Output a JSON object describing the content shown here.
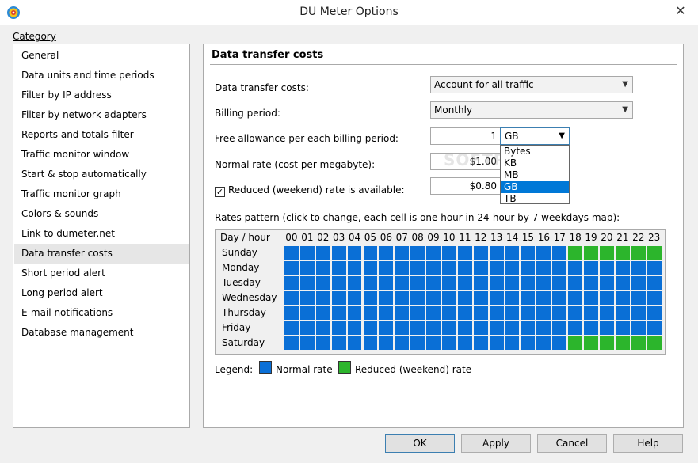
{
  "window": {
    "title": "DU Meter Options",
    "close_glyph": "✕"
  },
  "category": {
    "label": "Category",
    "items": [
      "General",
      "Data units and time periods",
      "Filter by IP address",
      "Filter by network adapters",
      "Reports and totals filter",
      "Traffic monitor window",
      "Start & stop automatically",
      "Traffic monitor graph",
      "Colors & sounds",
      "Link to dumeter.net",
      "Data transfer costs",
      "Short period alert",
      "Long period alert",
      "E-mail notifications",
      "Database management"
    ],
    "selected_index": 10
  },
  "panel": {
    "title": "Data transfer costs",
    "costs_label": "Data transfer costs:",
    "costs_value": "Account for all traffic",
    "billing_label": "Billing period:",
    "billing_value": "Monthly",
    "allowance_label": "Free allowance per each billing period:",
    "allowance_value": "1",
    "unit_value": "GB",
    "unit_options": [
      "Bytes",
      "KB",
      "MB",
      "GB",
      "TB"
    ],
    "unit_selected_index": 3,
    "normal_rate_label": "Normal rate (cost per megabyte):",
    "normal_rate_value": "$1.00",
    "reduced_label": "Reduced (weekend) rate is available:",
    "reduced_checked": true,
    "reduced_value": "$0.80",
    "pattern_label": "Rates pattern (click to change, each cell is one hour in 24-hour by 7 weekdays map):",
    "grid_header": "Day / hour",
    "hours": [
      "00",
      "01",
      "02",
      "03",
      "04",
      "05",
      "06",
      "07",
      "08",
      "09",
      "10",
      "11",
      "12",
      "13",
      "14",
      "15",
      "16",
      "17",
      "18",
      "19",
      "20",
      "21",
      "22",
      "23"
    ],
    "days": [
      "Sunday",
      "Monday",
      "Tuesday",
      "Wednesday",
      "Thursday",
      "Friday",
      "Saturday"
    ],
    "reduced_cells": {
      "Sunday": [
        18,
        19,
        20,
        21,
        22,
        23
      ],
      "Saturday": [
        18,
        19,
        20,
        21,
        22,
        23
      ]
    },
    "legend_label": "Legend:",
    "legend_normal": "Normal rate",
    "legend_reduced": "Reduced (weekend) rate"
  },
  "colors": {
    "normal": "#0a6fd6",
    "reduced": "#2cb52c",
    "selection": "#0078d7"
  },
  "buttons": {
    "ok": "OK",
    "apply": "Apply",
    "cancel": "Cancel",
    "help": "Help"
  }
}
